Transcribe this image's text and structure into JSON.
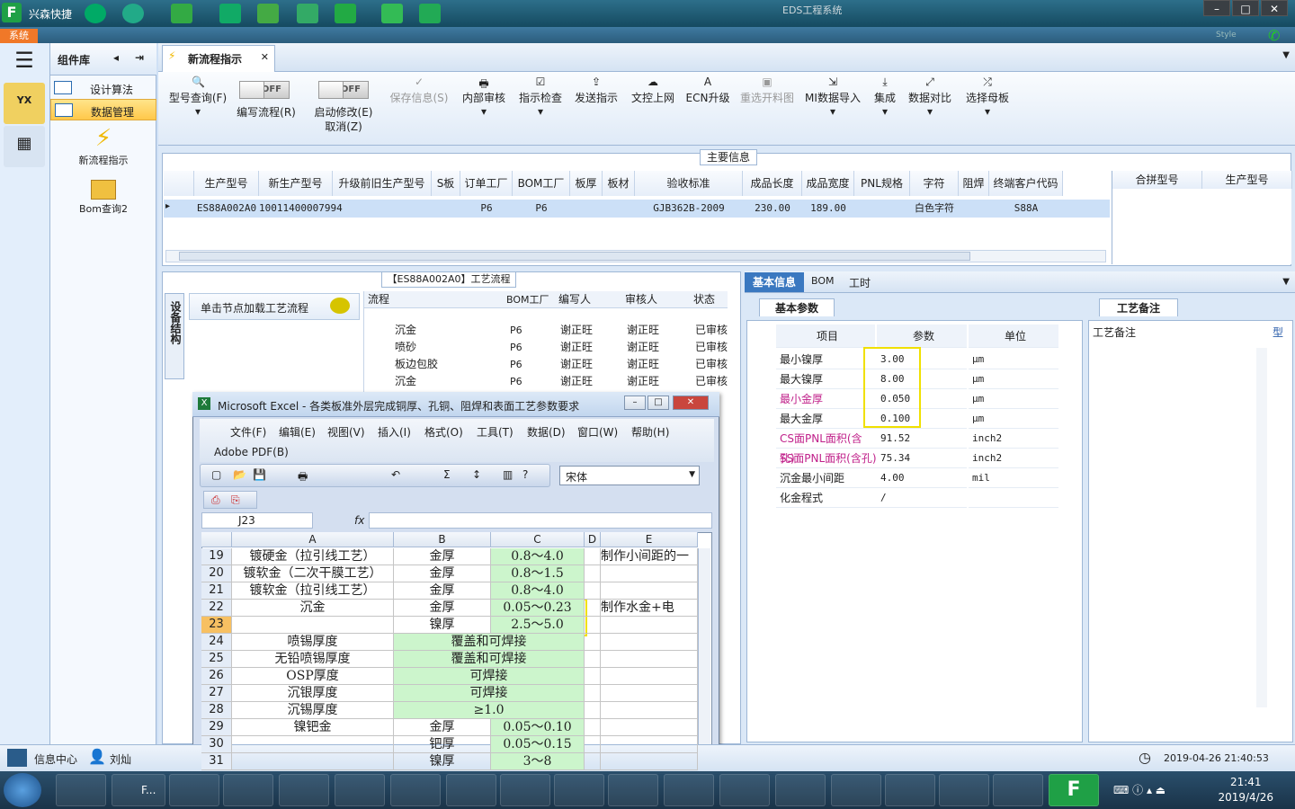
{
  "titlebar": {
    "app_name": "兴森快捷",
    "window_title": "EDS工程系统",
    "sys_tab": "系统",
    "style_label": "Style"
  },
  "components": {
    "title": "组件库",
    "items": [
      {
        "label": "设计算法"
      },
      {
        "label": "数据管理"
      }
    ],
    "big_items": [
      {
        "label": "新流程指示"
      },
      {
        "label": "Bom查询2"
      }
    ]
  },
  "tab": {
    "label": "新流程指示"
  },
  "ribbon": {
    "buttons": [
      {
        "label": "型号查询(F)"
      },
      {
        "label": "编写流程(R)",
        "toggle": "OFF"
      },
      {
        "label": "启动修改(E)",
        "sub": "取消(Z)",
        "toggle": "OFF"
      },
      {
        "label": "保存信息(S)"
      },
      {
        "label": "内部审核"
      },
      {
        "label": "指示检查"
      },
      {
        "label": "发送指示"
      },
      {
        "label": "文控上网"
      },
      {
        "label": "ECN升级"
      },
      {
        "label": "重选开料图"
      },
      {
        "label": "MI数据导入"
      },
      {
        "label": "集成"
      },
      {
        "label": "数据对比"
      },
      {
        "label": "选择母板"
      }
    ]
  },
  "main_info": {
    "title": "主要信息",
    "columns": [
      "生产型号",
      "新生产型号",
      "升级前旧生产型号",
      "S板",
      "订单工厂",
      "BOM工厂",
      "板厚",
      "板材",
      "验收标准",
      "成品长度",
      "成品宽度",
      "PNL规格",
      "字符",
      "阻焊",
      "终端客户代码"
    ],
    "row": [
      "ES88A002A0",
      "10011400007994",
      "",
      "",
      "P6",
      "P6",
      "",
      "",
      "GJB362B-2009",
      "230.00",
      "189.00",
      "",
      "白色字符",
      "",
      "S88A"
    ],
    "side_columns": [
      "合拼型号",
      "生产型号"
    ]
  },
  "process": {
    "title": "【ES88A002A0】工艺流程",
    "vtab": "设备结构",
    "load_button": "单击节点加载工艺流程",
    "columns": [
      "流程",
      "BOM工厂",
      "编写人",
      "审核人",
      "状态"
    ],
    "rows": [
      {
        "name": "沉金",
        "factory": "P6",
        "writer": "谢正旺",
        "reviewer": "谢正旺",
        "status": "已审核"
      },
      {
        "name": "喷砂",
        "factory": "P6",
        "writer": "谢正旺",
        "reviewer": "谢正旺",
        "status": "已审核"
      },
      {
        "name": "板边包胶",
        "factory": "P6",
        "writer": "谢正旺",
        "reviewer": "谢正旺",
        "status": "已审核"
      },
      {
        "name": "沉金",
        "factory": "P6",
        "writer": "谢正旺",
        "reviewer": "谢正旺",
        "status": "已审核"
      }
    ]
  },
  "right_tabs": [
    "基本信息",
    "BOM",
    "工时"
  ],
  "params": {
    "tab": "基本参数",
    "columns": [
      "项目",
      "参数",
      "单位"
    ],
    "rows": [
      {
        "item": "最小镍厚",
        "value": "3.00",
        "unit": "μm"
      },
      {
        "item": "最大镍厚",
        "value": "8.00",
        "unit": "μm"
      },
      {
        "item": "最小金厚",
        "value": "0.050",
        "unit": "μm"
      },
      {
        "item": "最大金厚",
        "value": "0.100",
        "unit": "μm"
      },
      {
        "item": "CS面PNL面积(含孔)",
        "value": "91.52",
        "unit": "inch2"
      },
      {
        "item": "SS面PNL面积(含孔)",
        "value": "75.34",
        "unit": "inch2"
      },
      {
        "item": "沉金最小间距",
        "value": "4.00",
        "unit": "mil"
      },
      {
        "item": "化金程式",
        "value": "/",
        "unit": ""
      }
    ]
  },
  "notes": {
    "tab": "工艺备注",
    "header": "工艺备注",
    "col2": "型"
  },
  "excel": {
    "title": "Microsoft Excel - 各类板准外层完成铜厚、孔铜、阻焊和表面工艺参数要求",
    "menus": [
      "文件(F)",
      "编辑(E)",
      "视图(V)",
      "插入(I)",
      "格式(O)",
      "工具(T)",
      "数据(D)",
      "窗口(W)",
      "帮助(H)"
    ],
    "menu2": "Adobe PDF(B)",
    "font": "宋体",
    "cell_ref": "J23",
    "fx": "fx",
    "cols": [
      "A",
      "B",
      "C",
      "D",
      "E"
    ],
    "rows": [
      {
        "n": "19",
        "a": "镀硬金（拉引线工艺）",
        "b": "金厚",
        "c": "0.8～4.0",
        "e": "制作小间距的一"
      },
      {
        "n": "20",
        "a": "镀软金（二次干膜工艺）",
        "b": "金厚",
        "c": "0.8～1.5",
        "e": ""
      },
      {
        "n": "21",
        "a": "镀软金（拉引线工艺）",
        "b": "金厚",
        "c": "0.8～4.0",
        "e": ""
      },
      {
        "n": "22",
        "a": "沉金",
        "b": "金厚",
        "c": "0.05～0.23",
        "e": "制作水金+电"
      },
      {
        "n": "23",
        "a": "",
        "b": "镍厚",
        "c": "2.5～5.0",
        "e": ""
      },
      {
        "n": "24",
        "a": "喷锡厚度",
        "b": "覆盖和可焊接",
        "c": "",
        "e": ""
      },
      {
        "n": "25",
        "a": "无铅喷锡厚度",
        "b": "覆盖和可焊接",
        "c": "",
        "e": ""
      },
      {
        "n": "26",
        "a": "OSP厚度",
        "b": "可焊接",
        "c": "",
        "e": ""
      },
      {
        "n": "27",
        "a": "沉银厚度",
        "b": "可焊接",
        "c": "",
        "e": ""
      },
      {
        "n": "28",
        "a": "沉锡厚度",
        "b": "≥1.0",
        "c": "",
        "e": ""
      },
      {
        "n": "29",
        "a": "镍钯金",
        "b": "金厚",
        "c": "0.05～0.10",
        "e": ""
      },
      {
        "n": "30",
        "a": "",
        "b": "钯厚",
        "c": "0.05～0.15",
        "e": ""
      },
      {
        "n": "31",
        "a": "",
        "b": "镍厚",
        "c": "3～8",
        "e": ""
      }
    ]
  },
  "status": {
    "info_center": "信息中心",
    "user": "刘灿",
    "datetime": "2019-04-26 21:40:53"
  },
  "taskbar": {
    "time": "21:41",
    "date": "2019/4/26",
    "f_label": "F..."
  }
}
